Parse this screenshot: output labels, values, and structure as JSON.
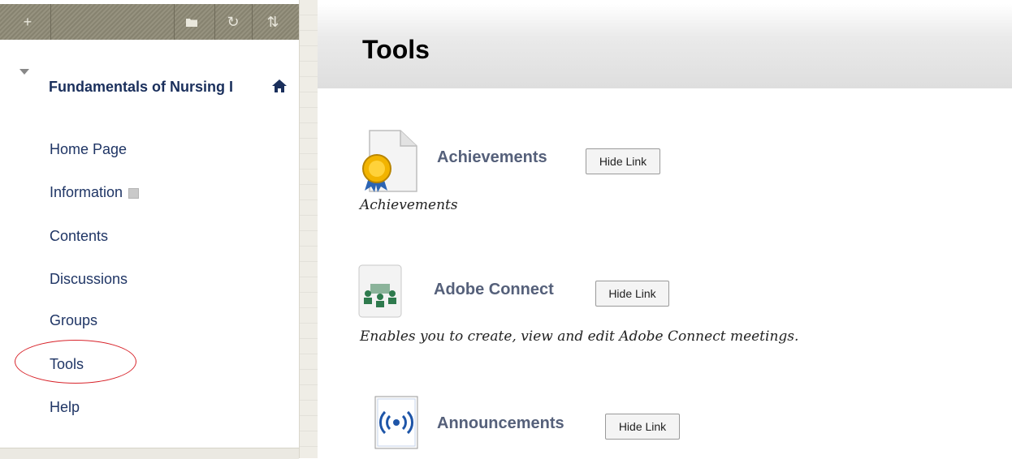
{
  "toolbar": {
    "buttons": [
      "plus-icon",
      "folder-icon",
      "refresh-icon",
      "sort-icon"
    ]
  },
  "menu": {
    "course_title": "Fundamentals of Nursing I",
    "items": [
      {
        "label": "Home Page"
      },
      {
        "label": "Information"
      },
      {
        "label": "Contents"
      },
      {
        "label": "Discussions"
      },
      {
        "label": "Groups"
      },
      {
        "label": "Tools"
      },
      {
        "label": "Help"
      }
    ],
    "highlight_color": "#d8242b"
  },
  "main": {
    "title": "Tools",
    "tools": [
      {
        "name": "Achievements",
        "button": "Hide Link",
        "description": "Achievements",
        "icon": "achievement-ribbon-icon"
      },
      {
        "name": "Adobe Connect",
        "button": "Hide Link",
        "description": "Enables you to create, view and edit Adobe Connect meetings.",
        "icon": "adobe-connect-icon"
      },
      {
        "name": "Announcements",
        "button": "Hide Link",
        "description": "",
        "icon": "announcements-icon"
      }
    ]
  }
}
